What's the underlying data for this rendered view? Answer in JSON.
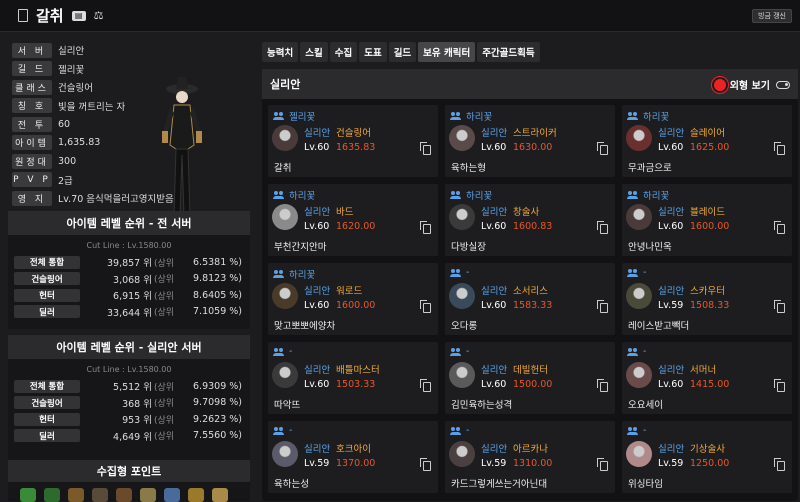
{
  "header": {
    "name": "갈취",
    "refresh_label": "빙금 갱신"
  },
  "profile": [
    {
      "label": "서 버",
      "value": "실리안"
    },
    {
      "label": "길 드",
      "value": "젤리꽃"
    },
    {
      "label": "클래스",
      "value": "건슬링어"
    },
    {
      "label": "칭 호",
      "value": "빛을 꺼트리는 자"
    },
    {
      "label": "전 투",
      "value": "60"
    },
    {
      "label": "아이템",
      "value": "1,635.83"
    },
    {
      "label": "원정대",
      "value": "300"
    },
    {
      "label": "P V P",
      "value": "2급"
    },
    {
      "label": "영 지",
      "value": "Lv.70 음식먹을러고영지받음"
    }
  ],
  "rank_all": {
    "title": "아이템 레벨 순위 - 전 서버",
    "cut": "Cut Line : Lv.1580.00",
    "rows": [
      {
        "label": "전체 통합",
        "num": "39,857 위",
        "txt": "(상위",
        "pct": "6.5381 %)"
      },
      {
        "label": "건슬링어",
        "num": "3,068 위",
        "txt": "(상위",
        "pct": "9.8123 %)"
      },
      {
        "label": "헌터",
        "num": "6,915 위",
        "txt": "(상위",
        "pct": "8.6405 %)"
      },
      {
        "label": "딜러",
        "num": "33,644 위",
        "txt": "(상위",
        "pct": "7.1059 %)"
      }
    ]
  },
  "rank_server": {
    "title": "아이템 레벨 순위 - 실리안 서버",
    "cut": "Cut Line : Lv.1580.00",
    "rows": [
      {
        "label": "전체 통합",
        "num": "5,512 위",
        "txt": "(상위",
        "pct": "6.9309 %)"
      },
      {
        "label": "건슬링어",
        "num": "368 위",
        "txt": "(상위",
        "pct": "9.7098 %)"
      },
      {
        "label": "헌터",
        "num": "953 위",
        "txt": "(상위",
        "pct": "9.2623 %)"
      },
      {
        "label": "딜러",
        "num": "4,649 위",
        "txt": "(상위",
        "pct": "7.5560 %)"
      }
    ]
  },
  "collect": {
    "title": "수집형 포인트"
  },
  "tabs": [
    "능력치",
    "스킬",
    "수집",
    "도표",
    "길드",
    "보유 캐릭터",
    "주간골드획득"
  ],
  "active_tab": "보유 캐릭터",
  "panel": {
    "server_title": "실리안",
    "appearance_label": "외형 보기"
  },
  "characters": [
    {
      "guild": "젤리꽃",
      "server": "실리안",
      "class": "건슬링어",
      "lv": "Lv.60",
      "ilvl": "1635.83",
      "name": "갈취"
    },
    {
      "guild": "하리꽃",
      "server": "실리안",
      "class": "스트라이커",
      "lv": "Lv.60",
      "ilvl": "1630.00",
      "name": "육하는형"
    },
    {
      "guild": "하리꽃",
      "server": "실리안",
      "class": "슬레이어",
      "lv": "Lv.60",
      "ilvl": "1625.00",
      "name": "무과금으로"
    },
    {
      "guild": "하리꽃",
      "server": "실리안",
      "class": "바드",
      "lv": "Lv.60",
      "ilvl": "1620.00",
      "name": "부천간지안마"
    },
    {
      "guild": "하리꽃",
      "server": "실리안",
      "class": "창술사",
      "lv": "Lv.60",
      "ilvl": "1600.83",
      "name": "다방실장"
    },
    {
      "guild": "하리꽃",
      "server": "실리안",
      "class": "블레이드",
      "lv": "Lv.60",
      "ilvl": "1600.00",
      "name": "안녕나민옥"
    },
    {
      "guild": "하리꽃",
      "server": "실리안",
      "class": "워로드",
      "lv": "Lv.60",
      "ilvl": "1600.00",
      "name": "맞고뽀뽀에양차"
    },
    {
      "guild": "-",
      "server": "실리안",
      "class": "소서리스",
      "lv": "Lv.60",
      "ilvl": "1583.33",
      "name": "오다롱"
    },
    {
      "guild": "-",
      "server": "실리안",
      "class": "스카우터",
      "lv": "Lv.59",
      "ilvl": "1508.33",
      "name": "레이스받고빽더"
    },
    {
      "guild": "-",
      "server": "실리안",
      "class": "배틀마스터",
      "lv": "Lv.60",
      "ilvl": "1503.33",
      "name": "따악뜨"
    },
    {
      "guild": "-",
      "server": "실리안",
      "class": "데빌헌터",
      "lv": "Lv.60",
      "ilvl": "1500.00",
      "name": "김민육하는성격"
    },
    {
      "guild": "-",
      "server": "실리안",
      "class": "서머너",
      "lv": "Lv.60",
      "ilvl": "1415.00",
      "name": "오요세이"
    },
    {
      "guild": "-",
      "server": "실리안",
      "class": "호크아이",
      "lv": "Lv.59",
      "ilvl": "1370.00",
      "name": "육하는성"
    },
    {
      "guild": "-",
      "server": "실리안",
      "class": "아르카나",
      "lv": "Lv.59",
      "ilvl": "1310.00",
      "name": "카드그렇게쓰는거아닌대"
    },
    {
      "guild": "-",
      "server": "실리안",
      "class": "기상술사",
      "lv": "Lv.59",
      "ilvl": "1250.00",
      "name": "위싱타임"
    }
  ],
  "colors": {
    "accent_blue": "#5aa2e8",
    "class_orange": "#f2a93b",
    "ilvl_red": "#e8562a"
  }
}
